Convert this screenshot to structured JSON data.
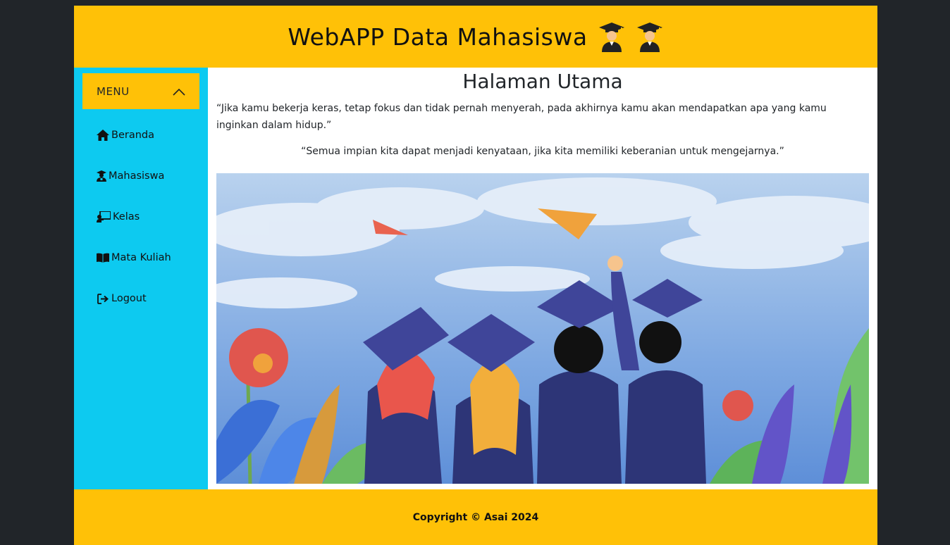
{
  "header": {
    "title": "WebAPP Data Mahasiswa",
    "title_icons": [
      "graduate-emoji",
      "graduate-emoji"
    ]
  },
  "sidebar": {
    "menu_toggle_label": "MENU",
    "menu_toggle_icon": "chevron-up-icon",
    "items": [
      {
        "label": "Beranda",
        "icon": "home-icon"
      },
      {
        "label": "Mahasiswa",
        "icon": "user-graduate-icon"
      },
      {
        "label": "Kelas",
        "icon": "chalkboard-teacher-icon"
      },
      {
        "label": "Mata Kuliah",
        "icon": "book-open-icon"
      },
      {
        "label": "Logout",
        "icon": "sign-out-icon"
      }
    ]
  },
  "main": {
    "title": "Halaman Utama",
    "quote1": "“Jika kamu bekerja keras, tetap fokus dan tidak pernah menyerah, pada akhirnya kamu akan mendapatkan apa yang kamu inginkan dalam hidup.”",
    "quote2": "“Semua impian kita dapat menjadi kenyataan, jika kita memiliki keberanian untuk mengejarnya.”"
  },
  "footer": {
    "copyright": "Copyright © Asai 2024"
  },
  "colors": {
    "background": "#212529",
    "header": "#ffc107",
    "sidebar": "#0dcaf0",
    "content": "#ffffff"
  }
}
